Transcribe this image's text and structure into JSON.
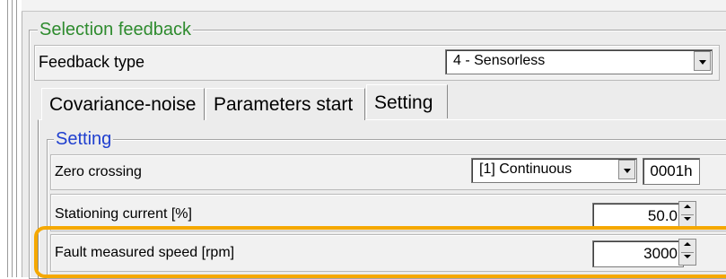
{
  "colors": {
    "groupbox_title": "#2e8b2e",
    "setting_title": "#1f3fcf",
    "highlight": "#f5a800",
    "panel_bg": "#ececec"
  },
  "selection_feedback": {
    "title": "Selection feedback",
    "feedback_type": {
      "label": "Feedback type",
      "value": "4 - Sensorless"
    }
  },
  "tabs": [
    {
      "label": "Covariance-noise",
      "active": false
    },
    {
      "label": "Parameters start",
      "active": false
    },
    {
      "label": "Setting",
      "active": true
    }
  ],
  "setting": {
    "title": "Setting",
    "zero_crossing": {
      "label": "Zero crossing",
      "value": "[1] Continuous",
      "hex": "0001h"
    },
    "stationing_current": {
      "label": "Stationing current [%]",
      "value": "50.0"
    },
    "fault_measured_speed": {
      "label": "Fault measured speed [rpm]",
      "value": "3000",
      "highlighted": true
    }
  },
  "icons": [
    "chevron-down-icon",
    "spin-up-icon",
    "spin-down-icon"
  ]
}
